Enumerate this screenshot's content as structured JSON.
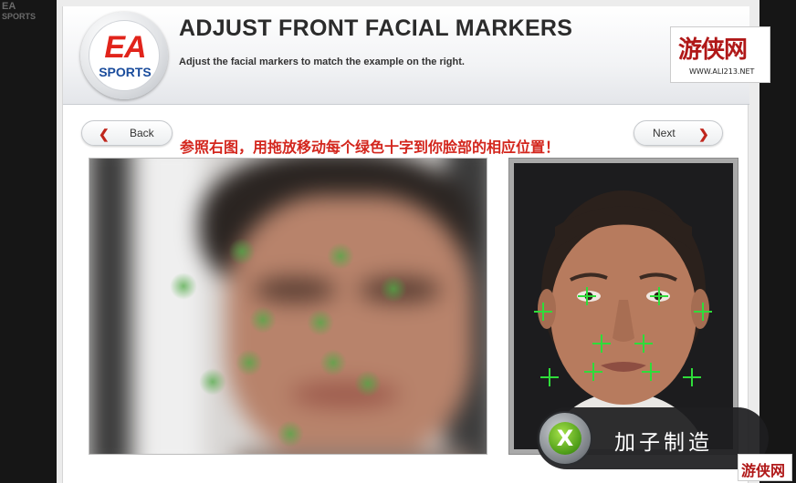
{
  "header": {
    "title": "ADJUST FRONT FACIAL MARKERS",
    "subtitle": "Adjust the facial markers to match the example on the right.",
    "logo_text_top": "EA",
    "logo_text_bottom": "SPORTS"
  },
  "corner_logo": {
    "line1": "EA",
    "line2": "SPORTS"
  },
  "site_badge": {
    "text": "游侠网",
    "url": "WWW.ALI213.NET"
  },
  "nav": {
    "back_label": "Back",
    "next_label": "Next"
  },
  "instruction": "参照右图，用拖放移动每个绿色十字到你脸部的相应位置！",
  "overlay": {
    "label": "加子制造",
    "button_glyph": "X"
  },
  "watermark_bottom": "游侠网",
  "colors": {
    "marker": "#2fdc3a",
    "accent_red": "#d3261d",
    "ea_red": "#e1241b",
    "ea_blue": "#1a4c9c"
  },
  "icons": {
    "back": "chevron-left-icon",
    "next": "chevron-right-icon",
    "marker": "crosshair-icon"
  }
}
